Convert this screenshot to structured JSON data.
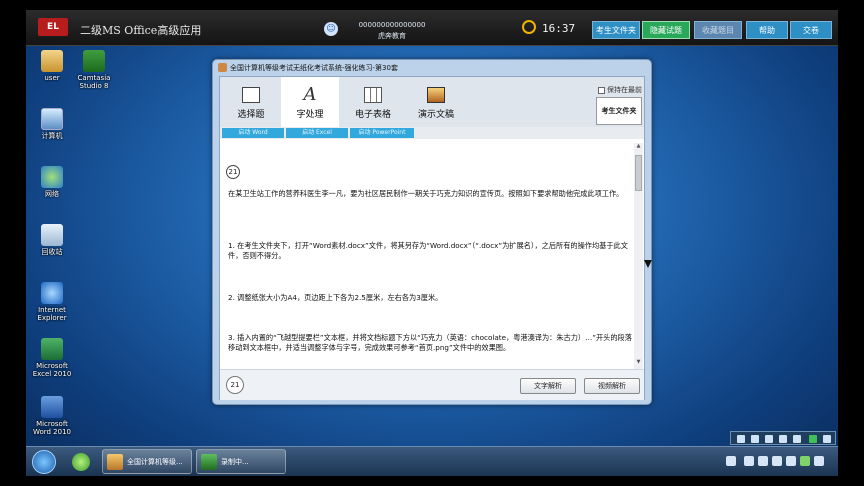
{
  "topbar": {
    "logo_text": "EL",
    "title": "二级MS Office高级应用",
    "exam_id": "000000000000000",
    "examinee_name": "虎奔教育",
    "time": "16:37",
    "buttons": {
      "examinee_folder": "考生文件夹",
      "hide_questions": "隐藏试题",
      "favorites": "收藏题目",
      "help": "帮助",
      "submit": "交卷"
    }
  },
  "desktop_icons": [
    {
      "label": "user"
    },
    {
      "label": "Camtasia Studio 8"
    },
    {
      "label": "计算机"
    },
    {
      "label": "网络"
    },
    {
      "label": "回收站"
    },
    {
      "label": "Internet Explorer"
    },
    {
      "label": "Microsoft Excel 2010"
    },
    {
      "label": "Microsoft Word 2010"
    }
  ],
  "window": {
    "title": "全国计算机等级考试无纸化考试系统-强化练习-第30套",
    "tabs": [
      {
        "label": "选择题"
      },
      {
        "label": "字处理"
      },
      {
        "label": "电子表格"
      },
      {
        "label": "演示文稿"
      }
    ],
    "keep_front_label": "保持在最前",
    "examinee_folder_label": "考生文件夹",
    "launch_buttons": [
      {
        "label": "启动 Word"
      },
      {
        "label": "启动 Excel"
      },
      {
        "label": "启动 PowerPoint"
      }
    ],
    "question_number": "21",
    "paragraphs": [
      "在某卫生站工作的营养科医生李一凡，要为社区居民制作一期关于巧克力知识的宣传页。按照如下要求帮助他完成此项工作。",
      "1. 在考生文件夹下，打开“Word素材.docx”文件，将其另存为“Word.docx”（“.docx”为扩展名），之后所有的操作均基于此文件，否则不得分。",
      "2. 调整纸张大小为A4，页边距上下各为2.5厘米，左右各为3厘米。",
      "3. 插入内置的“飞越型提要栏”文本框，并将文档标题下方以“巧克力（英语：chocolate，粤港澳译为：朱古力）…”开头的段落移动到文本框中，并适当调整字体与字号，完成效果可参考“首页.png”文件中的效果图。"
    ],
    "footer": {
      "question_number": "21",
      "text_analysis": "文字解析",
      "video_analysis": "视频解析"
    }
  },
  "taskbar": {
    "tasks": [
      {
        "label": "全国计算机等级..."
      },
      {
        "label": "录制中..."
      }
    ]
  }
}
